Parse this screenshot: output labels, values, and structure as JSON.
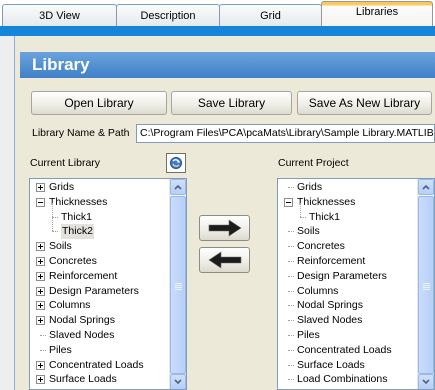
{
  "tabs": [
    {
      "label": "3D View"
    },
    {
      "label": "Description"
    },
    {
      "label": "Grid"
    },
    {
      "label": "Libraries"
    }
  ],
  "header": {
    "title": "Library"
  },
  "buttons": {
    "open": "Open Library",
    "save": "Save Library",
    "save_as": "Save As New Library"
  },
  "path": {
    "label": "Library Name & Path",
    "value": "C:\\Program Files\\PCA\\pcaMats\\Library\\Sample Library.MATLIB"
  },
  "current_library": {
    "label": "Current Library",
    "items": [
      {
        "label": "Grids",
        "level": 0,
        "expander": "plus"
      },
      {
        "label": "Thicknesses",
        "level": 0,
        "expander": "minus"
      },
      {
        "label": "Thick1",
        "level": 1,
        "expander": "none"
      },
      {
        "label": "Thick2",
        "level": 1,
        "expander": "none",
        "selected": true
      },
      {
        "label": "Soils",
        "level": 0,
        "expander": "plus"
      },
      {
        "label": "Concretes",
        "level": 0,
        "expander": "plus"
      },
      {
        "label": "Reinforcement",
        "level": 0,
        "expander": "plus"
      },
      {
        "label": "Design Parameters",
        "level": 0,
        "expander": "plus"
      },
      {
        "label": "Columns",
        "level": 0,
        "expander": "plus"
      },
      {
        "label": "Nodal Springs",
        "level": 0,
        "expander": "plus"
      },
      {
        "label": "Slaved Nodes",
        "level": 0,
        "expander": "none"
      },
      {
        "label": "Piles",
        "level": 0,
        "expander": "none"
      },
      {
        "label": "Concentrated Loads",
        "level": 0,
        "expander": "plus"
      },
      {
        "label": "Surface Loads",
        "level": 0,
        "expander": "plus"
      }
    ]
  },
  "current_project": {
    "label": "Current Project",
    "items": [
      {
        "label": "Grids",
        "level": 0,
        "expander": "none"
      },
      {
        "label": "Thicknesses",
        "level": 0,
        "expander": "minus"
      },
      {
        "label": "Thick1",
        "level": 1,
        "expander": "none"
      },
      {
        "label": "Soils",
        "level": 0,
        "expander": "none"
      },
      {
        "label": "Concretes",
        "level": 0,
        "expander": "none"
      },
      {
        "label": "Reinforcement",
        "level": 0,
        "expander": "none"
      },
      {
        "label": "Design Parameters",
        "level": 0,
        "expander": "none"
      },
      {
        "label": "Columns",
        "level": 0,
        "expander": "none"
      },
      {
        "label": "Nodal Springs",
        "level": 0,
        "expander": "none"
      },
      {
        "label": "Slaved Nodes",
        "level": 0,
        "expander": "none"
      },
      {
        "label": "Piles",
        "level": 0,
        "expander": "none"
      },
      {
        "label": "Concentrated Loads",
        "level": 0,
        "expander": "none"
      },
      {
        "label": "Surface Loads",
        "level": 0,
        "expander": "none"
      },
      {
        "label": "Load Combinations",
        "level": 0,
        "expander": "none"
      }
    ]
  },
  "icons": {
    "refresh": "refresh-icon",
    "copy_right": "arrow-right-icon",
    "copy_left": "arrow-left-icon"
  },
  "colors": {
    "header_blue": "#3f80c8",
    "active_tab_accent": "#ffc95a",
    "panel_beige": "#ece9d8"
  }
}
